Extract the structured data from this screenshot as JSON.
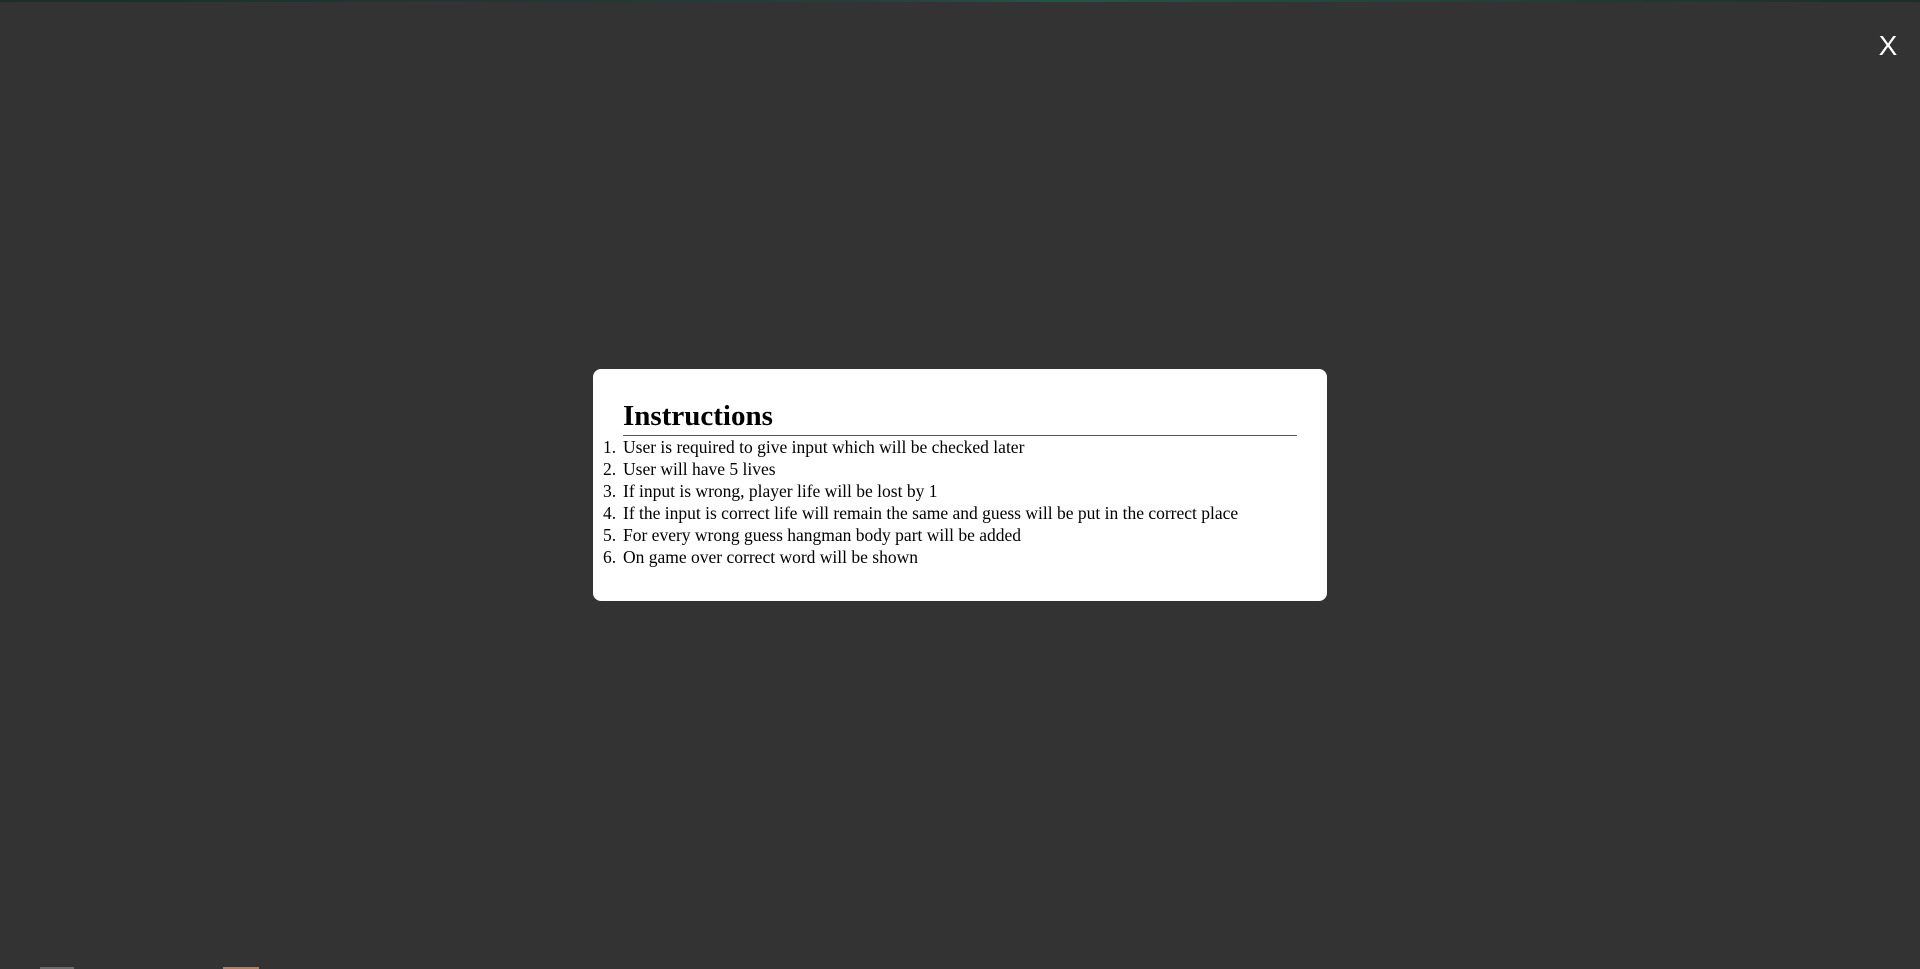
{
  "modal": {
    "title": "Instructions",
    "items": [
      {
        "num": "1.",
        "text": "User is required to give input which will be checked later"
      },
      {
        "num": "2.",
        "text": "User will have 5 lives"
      },
      {
        "num": "3.",
        "text": "If input is wrong, player life will be lost by 1"
      },
      {
        "num": "4.",
        "text": "If the input is correct life will remain the same and guess will be put in the correct place"
      },
      {
        "num": "5.",
        "text": "For every wrong guess hangman body part will be added"
      },
      {
        "num": "6.",
        "text": "On game over correct word will be shown"
      }
    ]
  },
  "close": {
    "label": "X"
  }
}
